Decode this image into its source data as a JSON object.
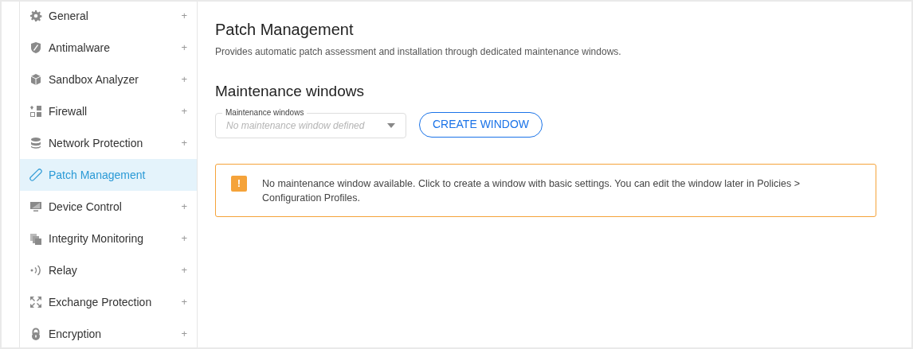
{
  "sidebar": {
    "items": [
      {
        "kind": "gear",
        "label": "General",
        "expander": "+",
        "selected": false
      },
      {
        "kind": "shield",
        "label": "Antimalware",
        "expander": "+",
        "selected": false
      },
      {
        "kind": "cube",
        "label": "Sandbox Analyzer",
        "expander": "+",
        "selected": false
      },
      {
        "kind": "blocks",
        "label": "Firewall",
        "expander": "+",
        "selected": false
      },
      {
        "kind": "database",
        "label": "Network Protection",
        "expander": "+",
        "selected": false
      },
      {
        "kind": "bandage",
        "label": "Patch Management",
        "selected": true
      },
      {
        "kind": "monitor",
        "label": "Device Control",
        "expander": "+",
        "selected": false
      },
      {
        "kind": "files",
        "label": "Integrity Monitoring",
        "expander": "+",
        "selected": false
      },
      {
        "kind": "signal",
        "label": "Relay",
        "expander": "+",
        "selected": false
      },
      {
        "kind": "arrows",
        "label": "Exchange Protection",
        "expander": "+",
        "selected": false
      },
      {
        "kind": "lock",
        "label": "Encryption",
        "expander": "+",
        "selected": false
      }
    ]
  },
  "page": {
    "title": "Patch Management",
    "subtitle": "Provides automatic patch assessment and installation through dedicated maintenance windows.",
    "section_title": "Maintenance windows",
    "select": {
      "label": "Maintenance windows",
      "placeholder": "No maintenance window defined",
      "disabled": true
    },
    "create_button": "CREATE WINDOW",
    "alert": {
      "icon": "!",
      "text": "No maintenance window available. Click to create a window with basic settings. You can edit the window later in Policies > Configuration Profiles."
    }
  }
}
